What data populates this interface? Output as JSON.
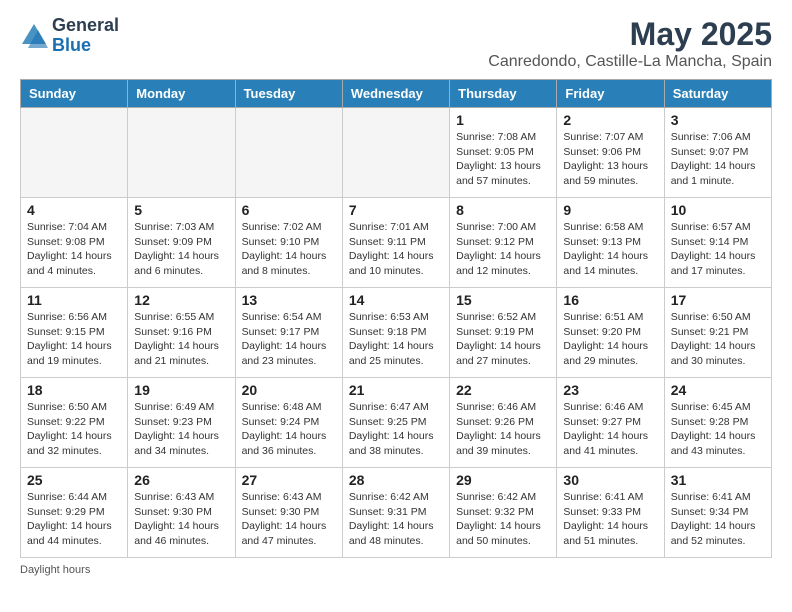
{
  "logo": {
    "general": "General",
    "blue": "Blue"
  },
  "title": "May 2025",
  "location": "Canredondo, Castille-La Mancha, Spain",
  "footer": "Daylight hours",
  "headers": [
    "Sunday",
    "Monday",
    "Tuesday",
    "Wednesday",
    "Thursday",
    "Friday",
    "Saturday"
  ],
  "weeks": [
    [
      {
        "day": "",
        "info": ""
      },
      {
        "day": "",
        "info": ""
      },
      {
        "day": "",
        "info": ""
      },
      {
        "day": "",
        "info": ""
      },
      {
        "day": "1",
        "info": "Sunrise: 7:08 AM\nSunset: 9:05 PM\nDaylight: 13 hours\nand 57 minutes."
      },
      {
        "day": "2",
        "info": "Sunrise: 7:07 AM\nSunset: 9:06 PM\nDaylight: 13 hours\nand 59 minutes."
      },
      {
        "day": "3",
        "info": "Sunrise: 7:06 AM\nSunset: 9:07 PM\nDaylight: 14 hours\nand 1 minute."
      }
    ],
    [
      {
        "day": "4",
        "info": "Sunrise: 7:04 AM\nSunset: 9:08 PM\nDaylight: 14 hours\nand 4 minutes."
      },
      {
        "day": "5",
        "info": "Sunrise: 7:03 AM\nSunset: 9:09 PM\nDaylight: 14 hours\nand 6 minutes."
      },
      {
        "day": "6",
        "info": "Sunrise: 7:02 AM\nSunset: 9:10 PM\nDaylight: 14 hours\nand 8 minutes."
      },
      {
        "day": "7",
        "info": "Sunrise: 7:01 AM\nSunset: 9:11 PM\nDaylight: 14 hours\nand 10 minutes."
      },
      {
        "day": "8",
        "info": "Sunrise: 7:00 AM\nSunset: 9:12 PM\nDaylight: 14 hours\nand 12 minutes."
      },
      {
        "day": "9",
        "info": "Sunrise: 6:58 AM\nSunset: 9:13 PM\nDaylight: 14 hours\nand 14 minutes."
      },
      {
        "day": "10",
        "info": "Sunrise: 6:57 AM\nSunset: 9:14 PM\nDaylight: 14 hours\nand 17 minutes."
      }
    ],
    [
      {
        "day": "11",
        "info": "Sunrise: 6:56 AM\nSunset: 9:15 PM\nDaylight: 14 hours\nand 19 minutes."
      },
      {
        "day": "12",
        "info": "Sunrise: 6:55 AM\nSunset: 9:16 PM\nDaylight: 14 hours\nand 21 minutes."
      },
      {
        "day": "13",
        "info": "Sunrise: 6:54 AM\nSunset: 9:17 PM\nDaylight: 14 hours\nand 23 minutes."
      },
      {
        "day": "14",
        "info": "Sunrise: 6:53 AM\nSunset: 9:18 PM\nDaylight: 14 hours\nand 25 minutes."
      },
      {
        "day": "15",
        "info": "Sunrise: 6:52 AM\nSunset: 9:19 PM\nDaylight: 14 hours\nand 27 minutes."
      },
      {
        "day": "16",
        "info": "Sunrise: 6:51 AM\nSunset: 9:20 PM\nDaylight: 14 hours\nand 29 minutes."
      },
      {
        "day": "17",
        "info": "Sunrise: 6:50 AM\nSunset: 9:21 PM\nDaylight: 14 hours\nand 30 minutes."
      }
    ],
    [
      {
        "day": "18",
        "info": "Sunrise: 6:50 AM\nSunset: 9:22 PM\nDaylight: 14 hours\nand 32 minutes."
      },
      {
        "day": "19",
        "info": "Sunrise: 6:49 AM\nSunset: 9:23 PM\nDaylight: 14 hours\nand 34 minutes."
      },
      {
        "day": "20",
        "info": "Sunrise: 6:48 AM\nSunset: 9:24 PM\nDaylight: 14 hours\nand 36 minutes."
      },
      {
        "day": "21",
        "info": "Sunrise: 6:47 AM\nSunset: 9:25 PM\nDaylight: 14 hours\nand 38 minutes."
      },
      {
        "day": "22",
        "info": "Sunrise: 6:46 AM\nSunset: 9:26 PM\nDaylight: 14 hours\nand 39 minutes."
      },
      {
        "day": "23",
        "info": "Sunrise: 6:46 AM\nSunset: 9:27 PM\nDaylight: 14 hours\nand 41 minutes."
      },
      {
        "day": "24",
        "info": "Sunrise: 6:45 AM\nSunset: 9:28 PM\nDaylight: 14 hours\nand 43 minutes."
      }
    ],
    [
      {
        "day": "25",
        "info": "Sunrise: 6:44 AM\nSunset: 9:29 PM\nDaylight: 14 hours\nand 44 minutes."
      },
      {
        "day": "26",
        "info": "Sunrise: 6:43 AM\nSunset: 9:30 PM\nDaylight: 14 hours\nand 46 minutes."
      },
      {
        "day": "27",
        "info": "Sunrise: 6:43 AM\nSunset: 9:30 PM\nDaylight: 14 hours\nand 47 minutes."
      },
      {
        "day": "28",
        "info": "Sunrise: 6:42 AM\nSunset: 9:31 PM\nDaylight: 14 hours\nand 48 minutes."
      },
      {
        "day": "29",
        "info": "Sunrise: 6:42 AM\nSunset: 9:32 PM\nDaylight: 14 hours\nand 50 minutes."
      },
      {
        "day": "30",
        "info": "Sunrise: 6:41 AM\nSunset: 9:33 PM\nDaylight: 14 hours\nand 51 minutes."
      },
      {
        "day": "31",
        "info": "Sunrise: 6:41 AM\nSunset: 9:34 PM\nDaylight: 14 hours\nand 52 minutes."
      }
    ]
  ]
}
